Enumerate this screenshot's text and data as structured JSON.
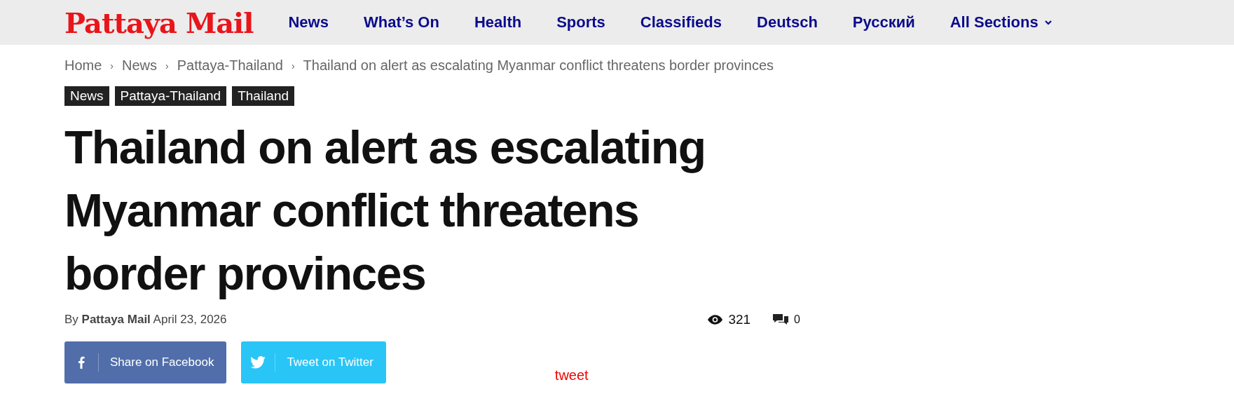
{
  "header": {
    "logo": "Pattaya Mail",
    "nav": [
      {
        "label": "News",
        "dropdown": false
      },
      {
        "label": "What’s On",
        "dropdown": false
      },
      {
        "label": "Health",
        "dropdown": false
      },
      {
        "label": "Sports",
        "dropdown": false
      },
      {
        "label": "Classifieds",
        "dropdown": false
      },
      {
        "label": "Deutsch",
        "dropdown": false
      },
      {
        "label": "Русский",
        "dropdown": false
      },
      {
        "label": "All Sections",
        "dropdown": true
      }
    ]
  },
  "breadcrumb_separator": "›",
  "breadcrumb": [
    "Home",
    "News",
    "Pattaya-Thailand",
    "Thailand on alert as escalating Myanmar conflict threatens border provinces"
  ],
  "tags": [
    "News",
    "Pattaya-Thailand",
    "Thailand"
  ],
  "article": {
    "title": "Thailand on alert as escalating Myanmar conflict threatens border provinces",
    "byline": "By **Pattaya Mail** April 23, 2026",
    "views": "321",
    "comments": "0"
  },
  "share": [
    {
      "kind": "facebook",
      "label": "Share on Facebook"
    },
    {
      "kind": "twitter",
      "label": "Tweet on Twitter"
    }
  ],
  "tweet_link": "tweet"
}
